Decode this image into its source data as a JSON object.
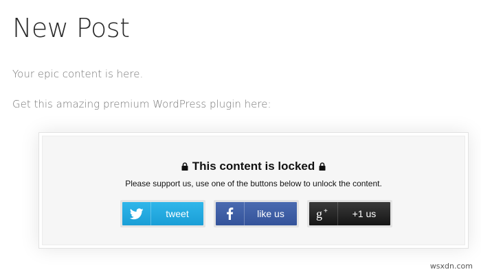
{
  "page": {
    "title": "New Post",
    "paragraphs": [
      "Your epic content is here.",
      "Get this amazing premium WordPress plugin here:"
    ]
  },
  "locker": {
    "heading": "This content is locked",
    "message": "Please support us, use one of the buttons below to unlock the content.",
    "icon": "lock-icon",
    "buttons": [
      {
        "network": "twitter",
        "icon": "twitter-bird-icon",
        "label": "tweet",
        "color": "#1ca8e0"
      },
      {
        "network": "facebook",
        "icon": "facebook-f-icon",
        "label": "like us",
        "color": "#3b5998"
      },
      {
        "network": "google-plus",
        "icon": "google-plus-icon",
        "label": "+1 us",
        "color": "#222222"
      }
    ]
  },
  "watermark": "wsxdn.com"
}
